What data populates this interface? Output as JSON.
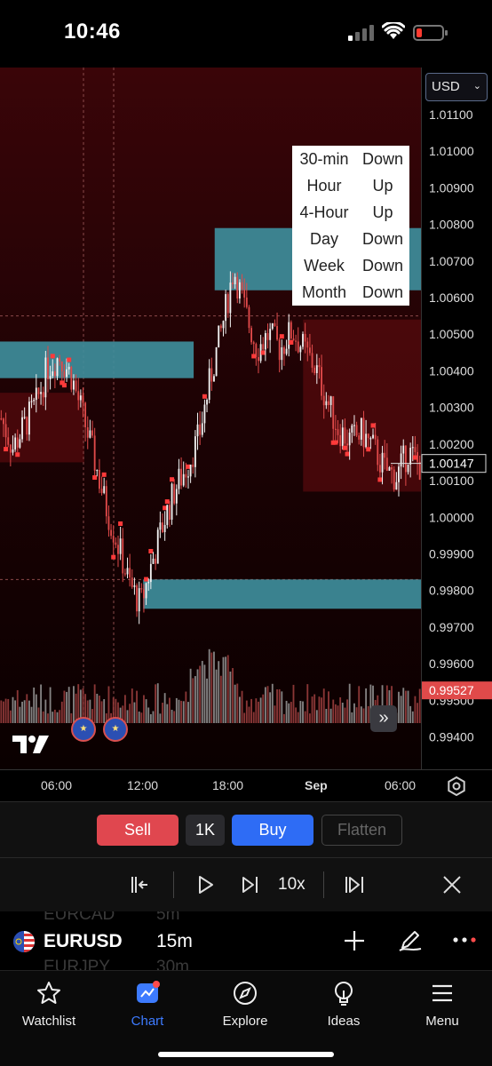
{
  "status": {
    "time": "10:46"
  },
  "chart": {
    "currency": "USD",
    "price_current": "1.00147",
    "price_marker": "0.99527",
    "colors": {
      "down": "#e04a4a",
      "up": "#f2f2f2",
      "zone": "#3e8d9b",
      "bg": "#1c0204"
    }
  },
  "trend_table": [
    {
      "timeframe": "30-min",
      "direction": "Down"
    },
    {
      "timeframe": "Hour",
      "direction": "Up"
    },
    {
      "timeframe": "4-Hour",
      "direction": "Up"
    },
    {
      "timeframe": "Day",
      "direction": "Down"
    },
    {
      "timeframe": "Week",
      "direction": "Down"
    },
    {
      "timeframe": "Month",
      "direction": "Down"
    }
  ],
  "time_axis": [
    "06:00",
    "12:00",
    "18:00",
    "Sep",
    "06:00"
  ],
  "chart_data": {
    "type": "candlestick",
    "yticks": [
      "1.01100",
      "1.01000",
      "1.00900",
      "1.00800",
      "1.00700",
      "1.00600",
      "1.00500",
      "1.00400",
      "1.00300",
      "1.00200",
      "1.00100",
      "1.00000",
      "0.99900",
      "0.99800",
      "0.99700",
      "0.99600",
      "0.99500",
      "0.99400"
    ],
    "ylim": [
      0.9936,
      1.0118
    ],
    "x_tick_labels": [
      "06:00",
      "12:00",
      "18:00",
      "Sep",
      "06:00"
    ],
    "zones": [
      {
        "x_start": 0.0,
        "x_end": 0.46,
        "y_low": 1.0038,
        "y_high": 1.0048
      },
      {
        "x_start": 0.51,
        "x_end": 1.0,
        "y_low": 1.0062,
        "y_high": 1.0079
      },
      {
        "x_start": 0.34,
        "x_end": 1.0,
        "y_low": 0.9975,
        "y_high": 0.9983
      }
    ],
    "shaded_regions": [
      {
        "x_start": 0.0,
        "x_end": 0.2,
        "y_low": 1.0015,
        "y_high": 1.0034
      },
      {
        "x_start": 0.72,
        "x_end": 1.0,
        "y_low": 1.0007,
        "y_high": 1.0054
      }
    ],
    "path": [
      1.0027,
      1.0019,
      1.0025,
      1.0031,
      1.0041,
      1.0044,
      1.0039,
      1.0028,
      1.0016,
      1.0003,
      0.9993,
      0.9982,
      0.9976,
      0.9988,
      0.9999,
      1.0008,
      1.0014,
      1.0022,
      1.0038,
      1.0052,
      1.0068,
      1.0056,
      1.0046,
      1.005,
      1.0046,
      1.0051,
      1.0046,
      1.0041,
      1.0032,
      1.0024,
      1.0021,
      1.0023,
      1.0019,
      1.0013,
      1.0011,
      1.0018,
      1.0014
    ]
  },
  "trade": {
    "sell": "Sell",
    "qty": "1K",
    "buy": "Buy",
    "flatten": "Flatten"
  },
  "replay": {
    "speed": "10x"
  },
  "symbol": {
    "ghost_prev_name": "EURCAD",
    "ghost_prev_interval": "5m",
    "name": "EURUSD",
    "interval": "15m",
    "ghost_next_name": "EURJPY",
    "ghost_next_interval": "30m"
  },
  "nav": [
    {
      "label": "Watchlist",
      "icon": "star-icon"
    },
    {
      "label": "Chart",
      "icon": "chart-icon"
    },
    {
      "label": "Explore",
      "icon": "compass-icon"
    },
    {
      "label": "Ideas",
      "icon": "lightbulb-icon"
    },
    {
      "label": "Menu",
      "icon": "menu-icon"
    }
  ]
}
